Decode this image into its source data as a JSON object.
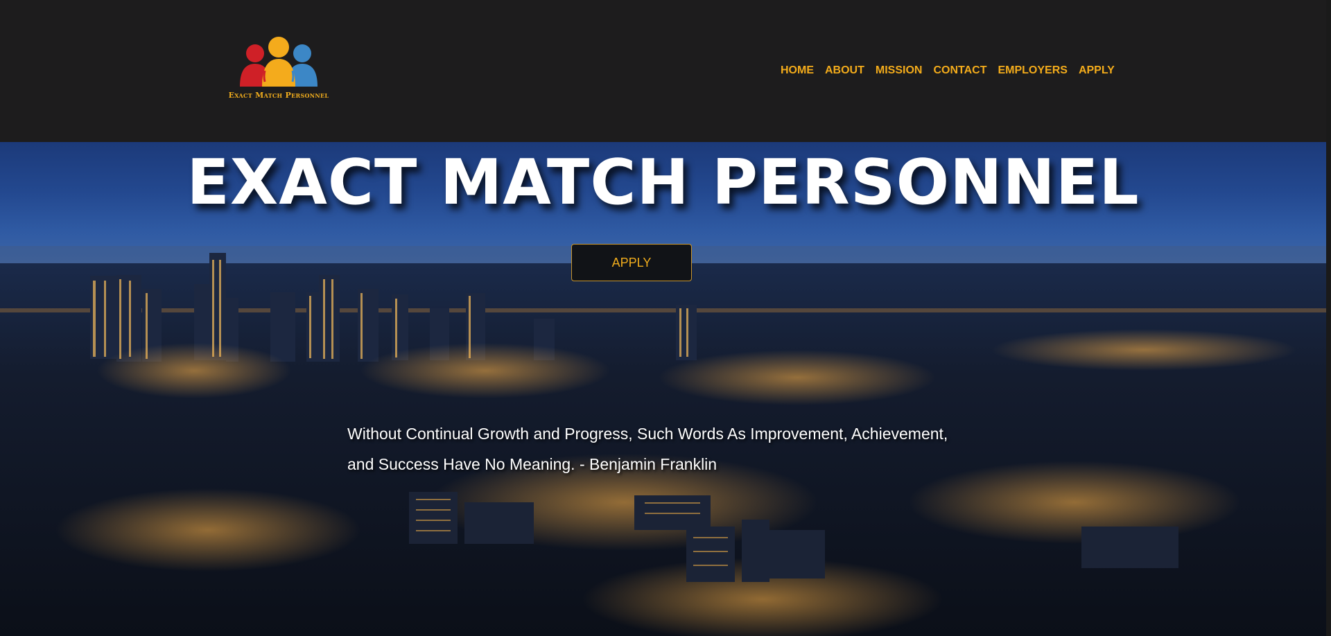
{
  "brand": {
    "name": "Exact Match Personnel",
    "logo_colors": [
      "#cf2027",
      "#f4ab1c",
      "#3c87c6"
    ]
  },
  "nav": {
    "items": [
      {
        "label": "HOME"
      },
      {
        "label": "ABOUT"
      },
      {
        "label": "MISSION"
      },
      {
        "label": "CONTACT"
      },
      {
        "label": "EMPLOYERS"
      },
      {
        "label": "APPLY"
      }
    ]
  },
  "hero": {
    "title": "EXACT MATCH PERSONNEL",
    "apply_label": "APPLY",
    "quote": "Without Continual Growth and Progress, Such Words As Improvement, Achievement, and Success Have No Meaning. - Benjamin Franklin"
  },
  "colors": {
    "header_bg": "#1d1c1d",
    "accent": "#f4ac1b",
    "button_bg": "#111317"
  }
}
